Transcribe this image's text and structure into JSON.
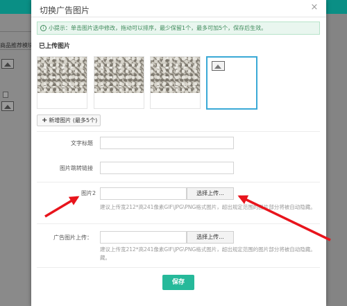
{
  "background": {
    "left_label": "商品推荐模块"
  },
  "modal": {
    "title": "切换广告图片",
    "close": "×"
  },
  "tip": {
    "icon": "i",
    "text": "小提示：单击图片选中修改，拖动可以排序，最少保留1个，最多可加5个，保存后生效。"
  },
  "uploaded": {
    "title": "已上传图片",
    "thumbnails": 4,
    "selected_index": 3
  },
  "add_button": {
    "icon": "+",
    "label": "新增图片 (最多5个)"
  },
  "form": {
    "text_title_label": "文字标题",
    "link_label": "图片跳转链接",
    "image2_label": "图片2",
    "image2_button": "选择上传...",
    "image2_hint": "建议上传宽212*高241像素GIF\\JPG\\PNG格式图片，超出规定范围的图片部分将被自动隐藏。",
    "ad_image_label": "广告图片上传：",
    "ad_image_button": "选择上传...",
    "ad_image_hint_line1": "建议上传宽212*高241像素GIF\\JPG\\PNG格式图片，超出规定范围的图片部分将被自动隐藏。",
    "ad_image_hint_line2": "藏。"
  },
  "save_button": "保存",
  "colors": {
    "accent": "#26b99a",
    "selected_border": "#39a9d6",
    "arrow": "#e8141c",
    "tip_bg": "#e9f6ef"
  }
}
